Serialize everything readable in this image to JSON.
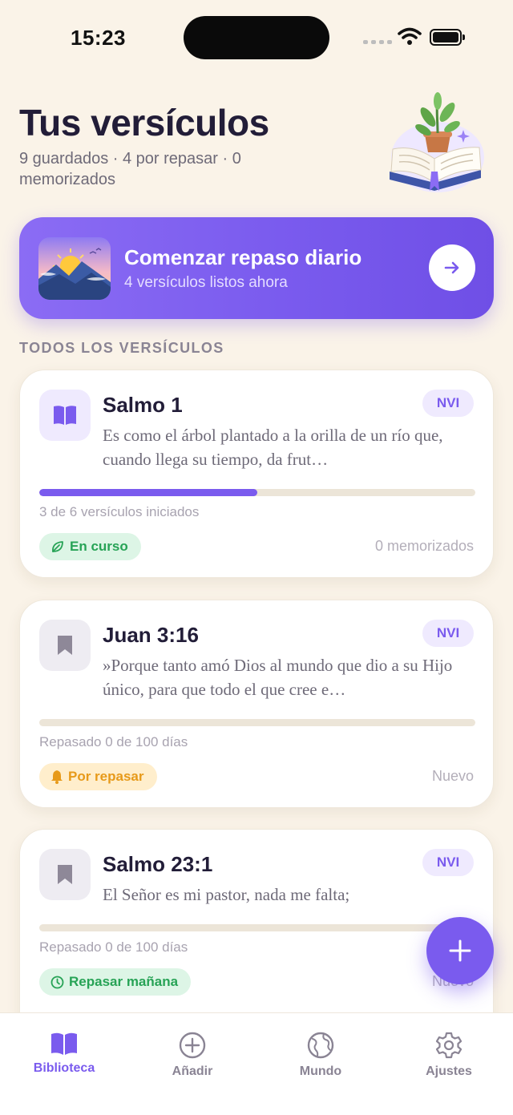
{
  "status_bar": {
    "time": "15:23"
  },
  "header": {
    "title": "Tus versículos",
    "subtitle": "9 guardados · 4 por repasar · 0 memorizados"
  },
  "cta": {
    "title": "Comenzar repaso diario",
    "subtitle": "4 versículos listos ahora",
    "icon": "arrow-right-icon"
  },
  "section_label": "TODOS LOS VERSÍCULOS",
  "cards": [
    {
      "title": "Salmo 1",
      "version": "NVI",
      "verse": "Es como el árbol plantado a la orilla de un río que, cuando llega su tiempo, da frut…",
      "progress_text": "3 de 6 versículos iniciados",
      "progress_fraction": 0.5,
      "status": "En curso",
      "status_icon": "leaf-icon",
      "right_meta": "0 memorizados",
      "icon": "open-book-icon"
    },
    {
      "title": "Juan 3:16",
      "version": "NVI",
      "verse": "»Porque tanto amó Dios al mundo que dio a su Hijo único, para que todo el que cree e…",
      "progress_text": "Repasado 0 de 100 días",
      "progress_fraction": 0,
      "status": "Por repasar",
      "status_icon": "bell-icon",
      "right_meta": "Nuevo",
      "icon": "bookmark-icon"
    },
    {
      "title": "Salmo 23:1",
      "version": "NVI",
      "verse": "El Señor es mi pastor, nada me falta;",
      "progress_text": "Repasado 0 de 100 días",
      "progress_fraction": 0,
      "status": "Repasar mañana",
      "status_icon": "clock-icon",
      "right_meta": "Nuevo",
      "icon": "bookmark-icon"
    }
  ],
  "nav": {
    "items": [
      {
        "label": "Biblioteca",
        "icon": "book-icon",
        "active": true
      },
      {
        "label": "Añadir",
        "icon": "plus-circle-icon",
        "active": false
      },
      {
        "label": "Mundo",
        "icon": "globe-icon",
        "active": false
      },
      {
        "label": "Ajustes",
        "icon": "gear-icon",
        "active": false
      }
    ]
  },
  "colors": {
    "accent": "#7A5BEE",
    "background": "#FAF3E8",
    "success": "#27A356",
    "warning": "#E79A1A"
  }
}
